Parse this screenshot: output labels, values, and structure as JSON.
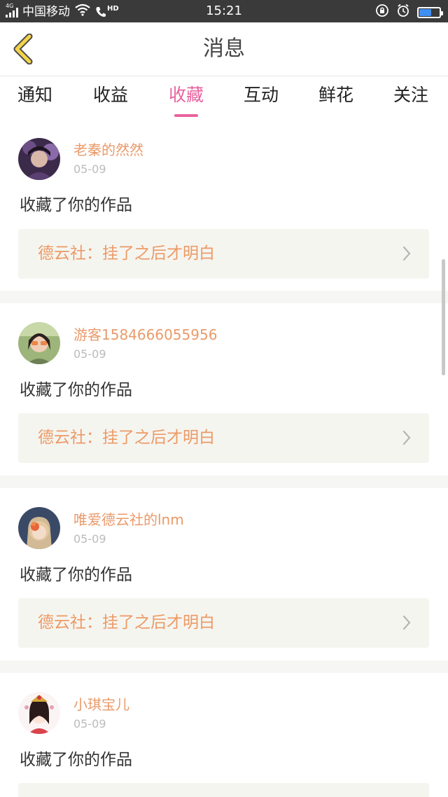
{
  "status_bar": {
    "network": "4G",
    "carrier": "中国移动",
    "hd": "HD",
    "time": "15:21"
  },
  "header": {
    "title": "消息",
    "back_icon": "chevron-left-icon"
  },
  "tabs": [
    {
      "label": "通知",
      "active": false
    },
    {
      "label": "收益",
      "active": false
    },
    {
      "label": "收藏",
      "active": true
    },
    {
      "label": "互动",
      "active": false
    },
    {
      "label": "鲜花",
      "active": false
    },
    {
      "label": "关注",
      "active": false
    }
  ],
  "messages": [
    {
      "username": "老秦的然然",
      "date": "05-09",
      "action": "收藏了你的作品",
      "work_title": "德云社：挂了之后才明白"
    },
    {
      "username": "游客1584666055956",
      "date": "05-09",
      "action": "收藏了你的作品",
      "work_title": "德云社：挂了之后才明白"
    },
    {
      "username": "唯爱德云社的lnm",
      "date": "05-09",
      "action": "收藏了你的作品",
      "work_title": "德云社：挂了之后才明白"
    },
    {
      "username": "小琪宝儿",
      "date": "05-09",
      "action": "收藏了你的作品",
      "work_title": ""
    }
  ],
  "colors": {
    "accent_pink": "#e8639e",
    "username_orange": "#ea9a6a",
    "work_title_orange": "#ec9a66",
    "back_yellow": "#f3d44a"
  }
}
